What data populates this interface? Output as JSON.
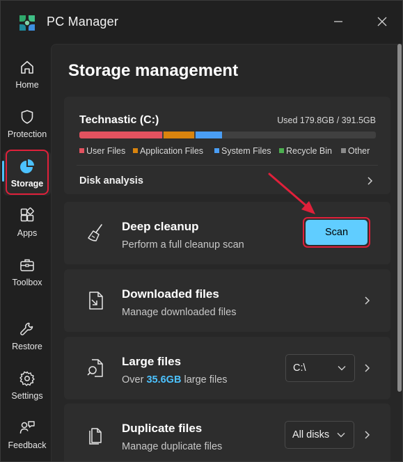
{
  "app": {
    "title": "PC Manager"
  },
  "sidebar": {
    "items": [
      {
        "label": "Home",
        "icon": "home-icon"
      },
      {
        "label": "Protection",
        "icon": "shield-icon"
      },
      {
        "label": "Storage",
        "icon": "storage-pie-icon",
        "active": true
      },
      {
        "label": "Apps",
        "icon": "apps-icon"
      },
      {
        "label": "Toolbox",
        "icon": "toolbox-icon"
      },
      {
        "label": "Restore",
        "icon": "wrench-icon"
      },
      {
        "label": "Settings",
        "icon": "gear-icon"
      },
      {
        "label": "Feedback",
        "icon": "feedback-icon"
      }
    ]
  },
  "main": {
    "title": "Storage management",
    "drive": {
      "name": "Technastic (C:)",
      "used_text": "Used 179.8GB / 391.5GB",
      "usage_fractions": {
        "user_files": 0.283,
        "application_files": 0.11,
        "system_files": 0.092
      },
      "legend": [
        {
          "label": "User Files",
          "color": "#e2525f"
        },
        {
          "label": "Application Files",
          "color": "#d9840e"
        },
        {
          "label": "System Files",
          "color": "#4a9ef5"
        },
        {
          "label": "Recycle Bin",
          "color": "#4caf50"
        },
        {
          "label": "Other",
          "color": "#8a8a8a"
        }
      ],
      "disk_analysis_label": "Disk analysis"
    },
    "deep_cleanup": {
      "title": "Deep cleanup",
      "subtitle": "Perform a full cleanup scan",
      "scan_label": "Scan"
    },
    "downloaded_files": {
      "title": "Downloaded files",
      "subtitle": "Manage downloaded files"
    },
    "large_files": {
      "title": "Large files",
      "subtitle_prefix": "Over ",
      "subtitle_value": "35.6GB",
      "subtitle_suffix": " large files",
      "drive_select": "C:\\"
    },
    "duplicate_files": {
      "title": "Duplicate files",
      "subtitle": "Manage duplicate files",
      "scope_select": "All disks"
    }
  },
  "colors": {
    "accent": "#60cdff",
    "highlight": "#e0203a"
  }
}
